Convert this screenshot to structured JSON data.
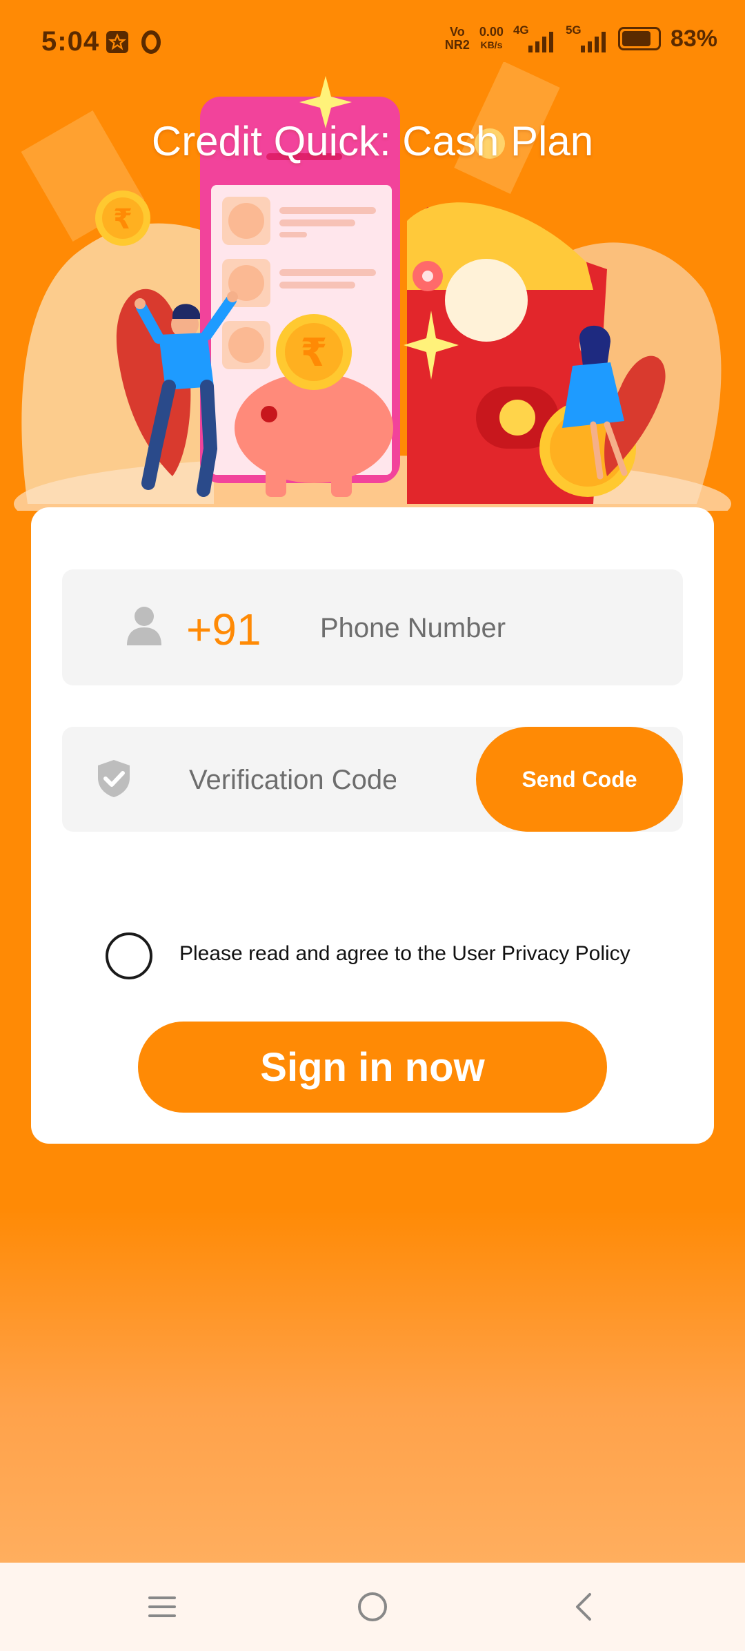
{
  "status_bar": {
    "time": "5:04",
    "network_vo": "Vo",
    "network_nr": "NR2",
    "speed_value": "0.00",
    "speed_unit": "KB/s",
    "net_4g": "4G",
    "net_5g": "5G",
    "battery_percent": "83%",
    "battery_level": 0.83,
    "icons": [
      "app-notification-icon",
      "o-app-icon",
      "signal-4g-icon",
      "signal-5g-icon",
      "battery-icon"
    ]
  },
  "hero": {
    "title": "Credit Quick: Cash Plan",
    "currency_symbol": "₹"
  },
  "form": {
    "phone_prefix": "+91",
    "phone_placeholder": "Phone Number",
    "code_placeholder": "Verification Code",
    "send_code_label": "Send Code",
    "policy_text": "Please read and agree to the User Privacy Policy",
    "signin_label": "Sign in now",
    "icons": [
      "user-icon",
      "shield-check-icon"
    ]
  },
  "nav_bar": {
    "icons": [
      "menu-icon",
      "home-icon",
      "back-icon"
    ]
  },
  "colors": {
    "accent": "#FF8A05",
    "field_bg": "#F4F4F4",
    "card_bg": "#FFFFFF",
    "nav_bg": "#FFF5EE"
  }
}
